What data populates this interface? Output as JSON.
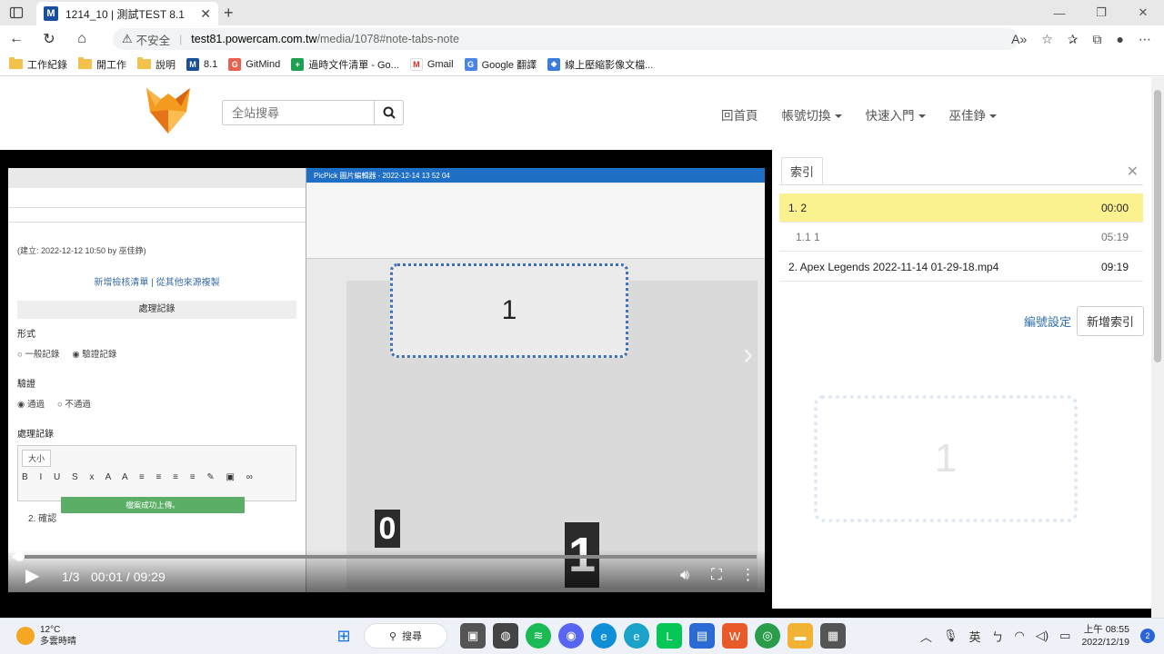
{
  "browser": {
    "tab_title": "1214_10 | 測試TEST 8.1",
    "tab_favicon": "M",
    "insecure_label": "不安全",
    "url_host": "test81.powercam.com.tw",
    "url_path": "/media/1078#note-tabs-note",
    "bookmarks": [
      {
        "label": "工作紀錄",
        "icon": "folder-icon"
      },
      {
        "label": "開工作",
        "icon": "folder-icon"
      },
      {
        "label": "說明",
        "icon": "folder-icon"
      },
      {
        "label": "8.1",
        "icon": "m-icon"
      },
      {
        "label": "GitMind",
        "icon": "gitmind-icon"
      },
      {
        "label": "過時文件清單 - Go...",
        "icon": "sheets-icon"
      },
      {
        "label": "Gmail",
        "icon": "gmail-icon"
      },
      {
        "label": "Google 翻譯",
        "icon": "translate-icon"
      },
      {
        "label": "線上壓縮影像文檔...",
        "icon": "compress-icon"
      }
    ]
  },
  "site": {
    "search_placeholder": "全站搜尋",
    "nav": {
      "home": "回首頁",
      "account_switch": "帳號切換",
      "quick_start": "快速入門",
      "user": "巫佳錚"
    }
  },
  "video": {
    "inner_title": "PicPick 圖片編輯器 - 2022-12-14 13 52 04",
    "note_text": "1",
    "badge_zero": "0",
    "badge_one": "1",
    "page_counter": "1/3",
    "time": "00:01 / 09:29",
    "progress_fraction": 0.002,
    "left_panel": {
      "created": "(建立: 2022-12-12 10:50 by 巫佳錚)",
      "links": "新增檢核清單 | 從其他來源複製",
      "section": "處理記錄",
      "form_label": "形式",
      "radio1": "一般記錄",
      "radio2": "驗證記錄",
      "verify_label": "驗證",
      "pass": "通過",
      "fail": "不通過",
      "record_label": "處理記錄",
      "size_label": "大小",
      "upload_msg": "檔案成功上傳。",
      "list_item": "2. 確認"
    }
  },
  "panel": {
    "tab_label": "索引",
    "rows": [
      {
        "title": "1. 2",
        "time": "00:00",
        "active": true
      },
      {
        "title": "1.1 1",
        "time": "05:19",
        "active": false
      },
      {
        "title": "2. Apex Legends 2022-11-14 01-29-18.mp4",
        "time": "09:19",
        "active": false
      }
    ],
    "numbering_link": "編號設定",
    "add_index_button": "新增索引",
    "ghost_text": "1"
  },
  "taskbar": {
    "temp": "12°C",
    "weather": "多雲時晴",
    "search_label": "搜尋",
    "ime": "英",
    "time": "上午 08:55",
    "date": "2022/12/19",
    "notifications": "2"
  }
}
